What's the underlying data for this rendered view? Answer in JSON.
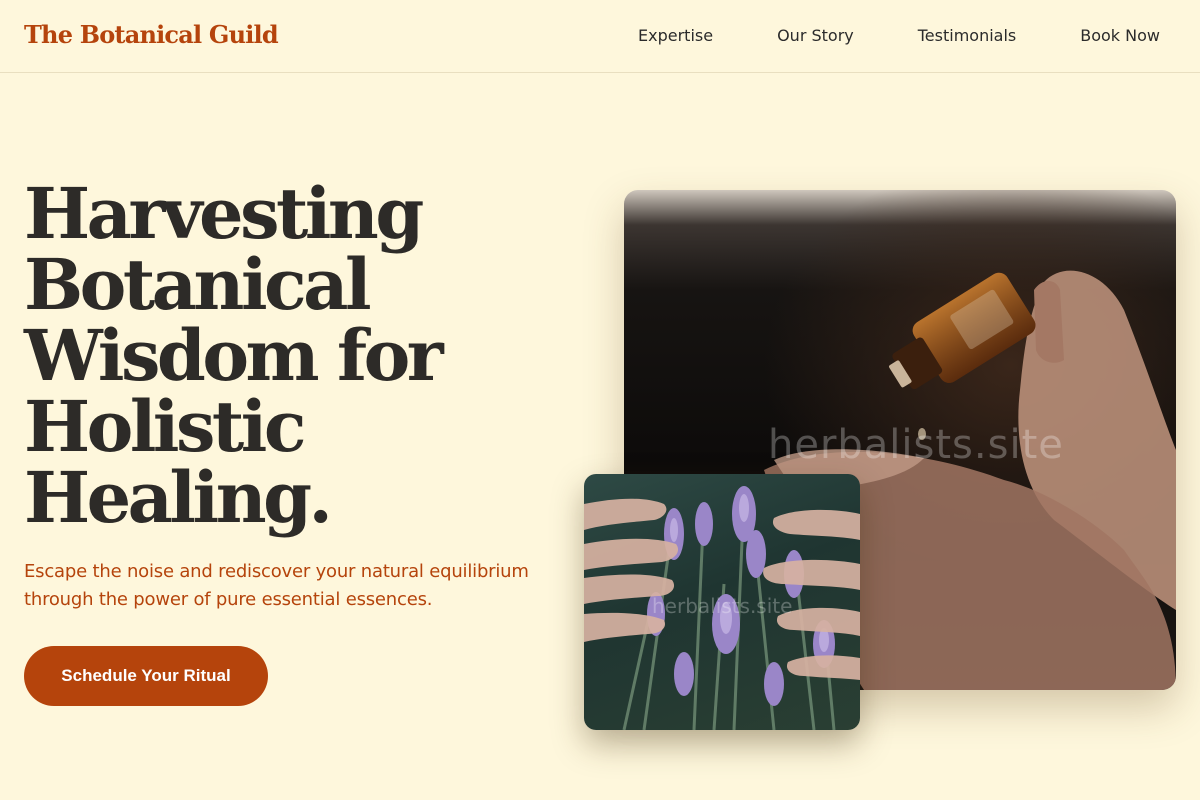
{
  "header": {
    "logo": "The Botanical Guild",
    "nav": [
      "Expertise",
      "Our Story",
      "Testimonials",
      "Book Now"
    ]
  },
  "hero": {
    "headline_lines": [
      "Harvesting",
      "Botanical",
      "Wisdom for",
      "Holistic",
      "Healing."
    ],
    "subtext": "Escape the noise and rediscover your natural equilibrium through the power of pure essential essences.",
    "cta_label": "Schedule Your Ritual"
  },
  "images": {
    "main_watermark": "herbalists.site",
    "small_watermark": "herbalists.site"
  },
  "colors": {
    "background": "#fef7dc",
    "accent": "#b5440c",
    "text": "#2d2b28"
  }
}
